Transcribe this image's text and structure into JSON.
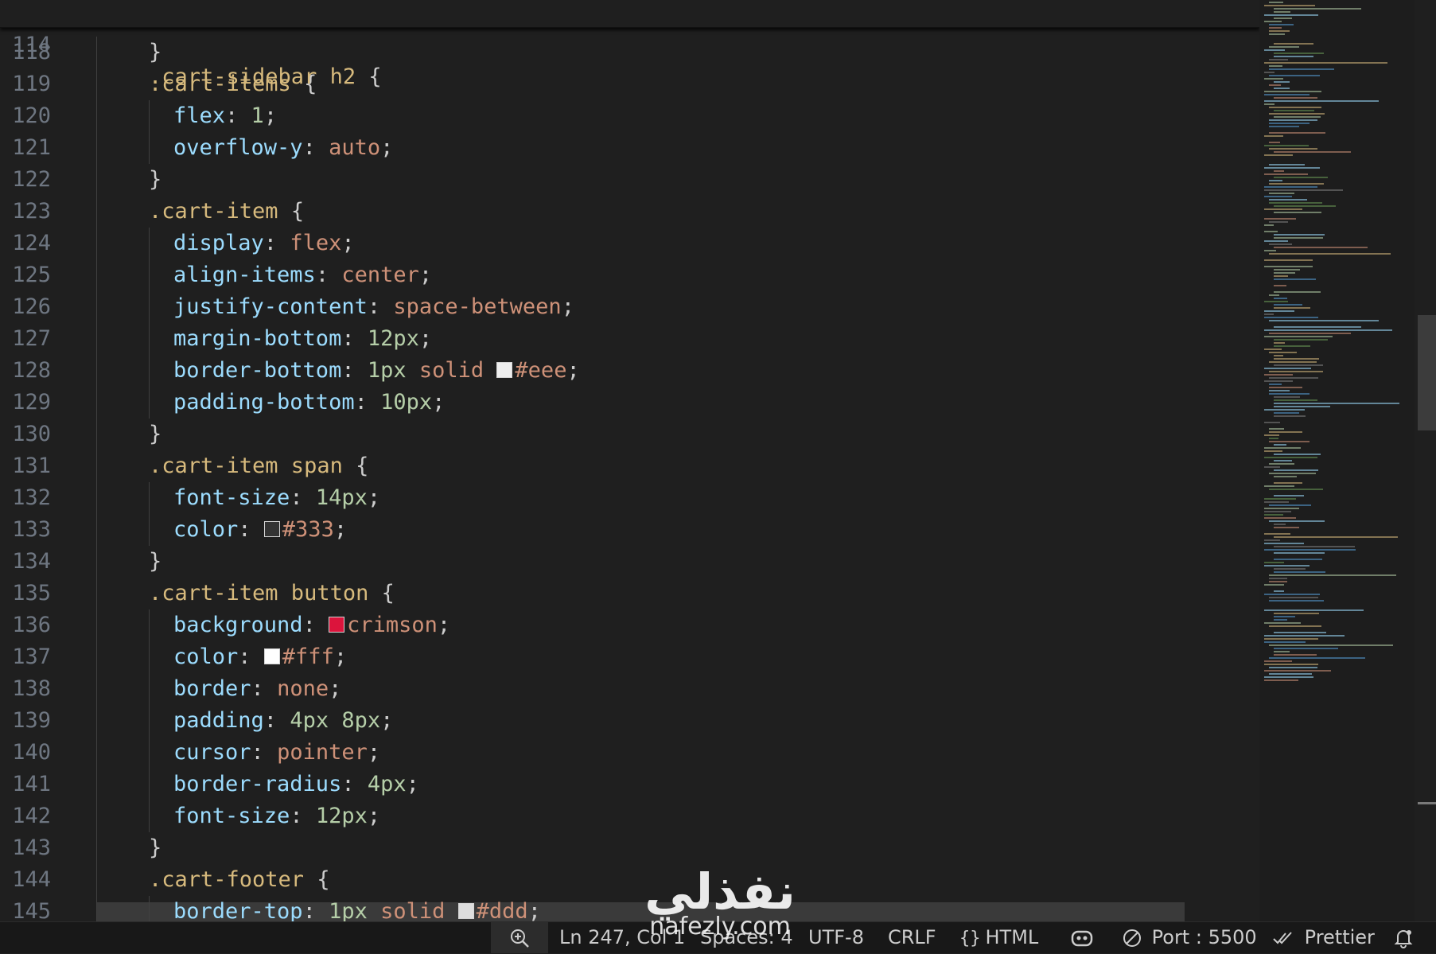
{
  "sticky": {
    "line_number": "114",
    "selector": ".cart-sidebar h2",
    "brace": " {"
  },
  "lines": [
    {
      "n": "118",
      "segs": [
        {
          "t": "}",
          "c": "punc"
        }
      ],
      "indent": 1
    },
    {
      "n": "119",
      "segs": [
        {
          "t": ".cart-items",
          "c": "sel"
        },
        {
          "t": " {",
          "c": "punc"
        }
      ],
      "indent": 1
    },
    {
      "n": "120",
      "segs": [
        {
          "t": "flex",
          "c": "prop"
        },
        {
          "t": ": ",
          "c": "punc"
        },
        {
          "t": "1",
          "c": "num"
        },
        {
          "t": ";",
          "c": "punc"
        }
      ],
      "indent": 2
    },
    {
      "n": "121",
      "segs": [
        {
          "t": "overflow-y",
          "c": "prop"
        },
        {
          "t": ": ",
          "c": "punc"
        },
        {
          "t": "auto",
          "c": "val"
        },
        {
          "t": ";",
          "c": "punc"
        }
      ],
      "indent": 2
    },
    {
      "n": "122",
      "segs": [
        {
          "t": "}",
          "c": "punc"
        }
      ],
      "indent": 1
    },
    {
      "n": "123",
      "segs": [
        {
          "t": ".cart-item",
          "c": "sel"
        },
        {
          "t": " {",
          "c": "punc"
        }
      ],
      "indent": 1
    },
    {
      "n": "124",
      "segs": [
        {
          "t": "display",
          "c": "prop"
        },
        {
          "t": ": ",
          "c": "punc"
        },
        {
          "t": "flex",
          "c": "val"
        },
        {
          "t": ";",
          "c": "punc"
        }
      ],
      "indent": 2
    },
    {
      "n": "125",
      "segs": [
        {
          "t": "align-items",
          "c": "prop"
        },
        {
          "t": ": ",
          "c": "punc"
        },
        {
          "t": "center",
          "c": "val"
        },
        {
          "t": ";",
          "c": "punc"
        }
      ],
      "indent": 2
    },
    {
      "n": "126",
      "segs": [
        {
          "t": "justify-content",
          "c": "prop"
        },
        {
          "t": ": ",
          "c": "punc"
        },
        {
          "t": "space-between",
          "c": "val"
        },
        {
          "t": ";",
          "c": "punc"
        }
      ],
      "indent": 2
    },
    {
      "n": "127",
      "segs": [
        {
          "t": "margin-bottom",
          "c": "prop"
        },
        {
          "t": ": ",
          "c": "punc"
        },
        {
          "t": "12px",
          "c": "num"
        },
        {
          "t": ";",
          "c": "punc"
        }
      ],
      "indent": 2
    },
    {
      "n": "128",
      "segs": [
        {
          "t": "border-bottom",
          "c": "prop"
        },
        {
          "t": ": ",
          "c": "punc"
        },
        {
          "t": "1px",
          "c": "num"
        },
        {
          "t": " solid ",
          "c": "val"
        },
        {
          "sw": "#eeeeee"
        },
        {
          "t": "#eee",
          "c": "val"
        },
        {
          "t": ";",
          "c": "punc"
        }
      ],
      "indent": 2
    },
    {
      "n": "129",
      "segs": [
        {
          "t": "padding-bottom",
          "c": "prop"
        },
        {
          "t": ": ",
          "c": "punc"
        },
        {
          "t": "10px",
          "c": "num"
        },
        {
          "t": ";",
          "c": "punc"
        }
      ],
      "indent": 2
    },
    {
      "n": "130",
      "segs": [
        {
          "t": "}",
          "c": "punc"
        }
      ],
      "indent": 1
    },
    {
      "n": "131",
      "segs": [
        {
          "t": ".cart-item span",
          "c": "sel"
        },
        {
          "t": " {",
          "c": "punc"
        }
      ],
      "indent": 1
    },
    {
      "n": "132",
      "segs": [
        {
          "t": "font-size",
          "c": "prop"
        },
        {
          "t": ": ",
          "c": "punc"
        },
        {
          "t": "14px",
          "c": "num"
        },
        {
          "t": ";",
          "c": "punc"
        }
      ],
      "indent": 2
    },
    {
      "n": "133",
      "segs": [
        {
          "t": "color",
          "c": "prop"
        },
        {
          "t": ": ",
          "c": "punc"
        },
        {
          "sw": "#333333"
        },
        {
          "t": "#333",
          "c": "val"
        },
        {
          "t": ";",
          "c": "punc"
        }
      ],
      "indent": 2
    },
    {
      "n": "134",
      "segs": [
        {
          "t": "}",
          "c": "punc"
        }
      ],
      "indent": 1
    },
    {
      "n": "135",
      "segs": [
        {
          "t": ".cart-item button",
          "c": "sel"
        },
        {
          "t": " {",
          "c": "punc"
        }
      ],
      "indent": 1
    },
    {
      "n": "136",
      "segs": [
        {
          "t": "background",
          "c": "prop"
        },
        {
          "t": ": ",
          "c": "punc"
        },
        {
          "sw": "#dc143c"
        },
        {
          "t": "crimson",
          "c": "val"
        },
        {
          "t": ";",
          "c": "punc"
        }
      ],
      "indent": 2
    },
    {
      "n": "137",
      "segs": [
        {
          "t": "color",
          "c": "prop"
        },
        {
          "t": ": ",
          "c": "punc"
        },
        {
          "sw": "#ffffff"
        },
        {
          "t": "#fff",
          "c": "val"
        },
        {
          "t": ";",
          "c": "punc"
        }
      ],
      "indent": 2
    },
    {
      "n": "138",
      "segs": [
        {
          "t": "border",
          "c": "prop"
        },
        {
          "t": ": ",
          "c": "punc"
        },
        {
          "t": "none",
          "c": "val"
        },
        {
          "t": ";",
          "c": "punc"
        }
      ],
      "indent": 2
    },
    {
      "n": "139",
      "segs": [
        {
          "t": "padding",
          "c": "prop"
        },
        {
          "t": ": ",
          "c": "punc"
        },
        {
          "t": "4px 8px",
          "c": "num"
        },
        {
          "t": ";",
          "c": "punc"
        }
      ],
      "indent": 2
    },
    {
      "n": "140",
      "segs": [
        {
          "t": "cursor",
          "c": "prop"
        },
        {
          "t": ": ",
          "c": "punc"
        },
        {
          "t": "pointer",
          "c": "val"
        },
        {
          "t": ";",
          "c": "punc"
        }
      ],
      "indent": 2
    },
    {
      "n": "141",
      "segs": [
        {
          "t": "border-radius",
          "c": "prop"
        },
        {
          "t": ": ",
          "c": "punc"
        },
        {
          "t": "4px",
          "c": "num"
        },
        {
          "t": ";",
          "c": "punc"
        }
      ],
      "indent": 2
    },
    {
      "n": "142",
      "segs": [
        {
          "t": "font-size",
          "c": "prop"
        },
        {
          "t": ": ",
          "c": "punc"
        },
        {
          "t": "12px",
          "c": "num"
        },
        {
          "t": ";",
          "c": "punc"
        }
      ],
      "indent": 2
    },
    {
      "n": "143",
      "segs": [
        {
          "t": "}",
          "c": "punc"
        }
      ],
      "indent": 1
    },
    {
      "n": "144",
      "segs": [
        {
          "t": ".cart-footer",
          "c": "sel"
        },
        {
          "t": " {",
          "c": "punc"
        }
      ],
      "indent": 1
    },
    {
      "n": "145",
      "segs": [
        {
          "t": "border-top",
          "c": "prop"
        },
        {
          "t": ": ",
          "c": "punc"
        },
        {
          "t": "1px",
          "c": "num"
        },
        {
          "t": " solid ",
          "c": "val"
        },
        {
          "sw": "#dddddd"
        },
        {
          "t": "#ddd",
          "c": "val"
        },
        {
          "t": ";",
          "c": "punc"
        }
      ],
      "indent": 2
    }
  ],
  "statusbar": {
    "cursor_position": "Ln 247, Col 1",
    "spaces": "Spaces: 4",
    "encoding": "UTF-8",
    "eol": "CRLF",
    "language": "HTML",
    "port": "Port : 5500",
    "formatter": "Prettier"
  },
  "watermark": {
    "arabic": "نفذلي",
    "latin": "nafezly.com"
  },
  "colors": {
    "background": "#1f1f1f",
    "selector": "#d7ba7d",
    "property": "#9cdcfe",
    "value": "#ce9178",
    "number": "#b5cea8",
    "line_number": "#6e7681"
  }
}
